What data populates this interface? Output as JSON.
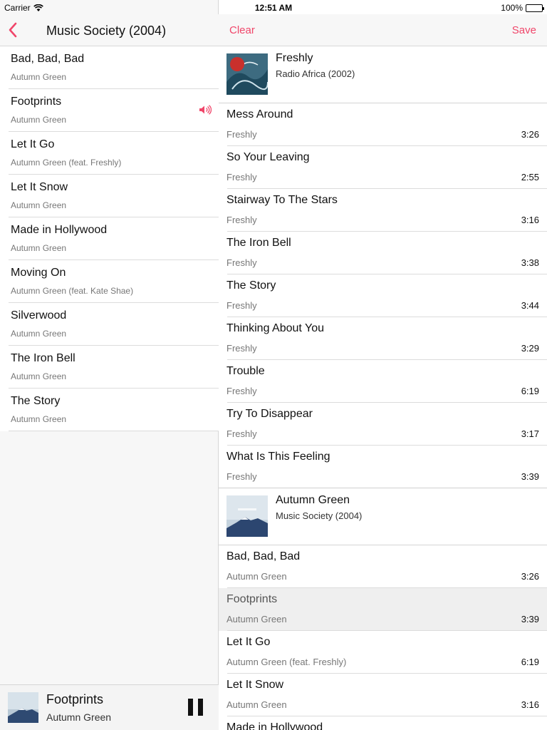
{
  "status_bar": {
    "carrier": "Carrier",
    "time": "12:51 AM",
    "battery": "100%"
  },
  "left": {
    "title": "Music Society (2004)",
    "tracks": [
      {
        "title": "Bad, Bad, Bad",
        "subtitle": "Autumn Green"
      },
      {
        "title": "Footprints",
        "subtitle": "Autumn Green",
        "playing": true
      },
      {
        "title": "Let It Go",
        "subtitle": "Autumn Green (feat. Freshly)"
      },
      {
        "title": "Let It Snow",
        "subtitle": "Autumn Green"
      },
      {
        "title": "Made in Hollywood",
        "subtitle": "Autumn Green"
      },
      {
        "title": "Moving On",
        "subtitle": "Autumn Green (feat. Kate Shae)"
      },
      {
        "title": "Silverwood",
        "subtitle": "Autumn Green"
      },
      {
        "title": "The Iron Bell",
        "subtitle": "Autumn Green"
      },
      {
        "title": "The Story",
        "subtitle": "Autumn Green"
      }
    ]
  },
  "mini_player": {
    "title": "Footprints",
    "artist": "Autumn Green"
  },
  "right": {
    "clear_label": "Clear",
    "save_label": "Save",
    "accent": "#f0466a",
    "albums": [
      {
        "artist": "Freshly",
        "album": "Radio Africa (2002)",
        "tracks": [
          {
            "title": "Mess Around",
            "artist": "Freshly",
            "duration": "3:26"
          },
          {
            "title": "So Your Leaving",
            "artist": "Freshly",
            "duration": "2:55"
          },
          {
            "title": "Stairway To The Stars",
            "artist": "Freshly",
            "duration": "3:16"
          },
          {
            "title": "The Iron Bell",
            "artist": "Freshly",
            "duration": "3:38"
          },
          {
            "title": "The Story",
            "artist": "Freshly",
            "duration": "3:44"
          },
          {
            "title": "Thinking About You",
            "artist": "Freshly",
            "duration": "3:29"
          },
          {
            "title": "Trouble",
            "artist": "Freshly",
            "duration": "6:19"
          },
          {
            "title": "Try To Disappear",
            "artist": "Freshly",
            "duration": "3:17"
          },
          {
            "title": "What Is This Feeling",
            "artist": "Freshly",
            "duration": "3:39"
          }
        ]
      },
      {
        "artist": "Autumn Green",
        "album": "Music Society (2004)",
        "tracks": [
          {
            "title": "Bad, Bad, Bad",
            "artist": "Autumn Green",
            "duration": "3:26"
          },
          {
            "title": "Footprints",
            "artist": "Autumn Green",
            "duration": "3:39",
            "playing": true
          },
          {
            "title": "Let It Go",
            "artist": "Autumn Green (feat. Freshly)",
            "duration": "6:19"
          },
          {
            "title": "Let It Snow",
            "artist": "Autumn Green",
            "duration": "3:16"
          },
          {
            "title": "Made in Hollywood",
            "artist": "",
            "duration": ""
          }
        ]
      }
    ]
  }
}
